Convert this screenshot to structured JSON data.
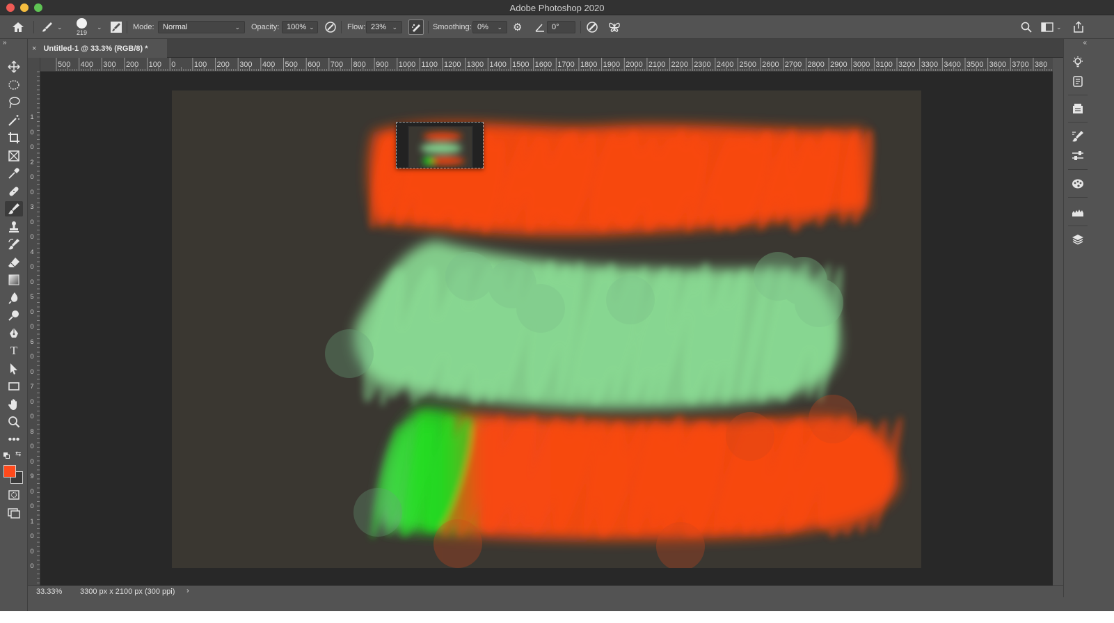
{
  "window": {
    "title": "Adobe Photoshop 2020"
  },
  "options_bar": {
    "brush_size": "219",
    "mode_label": "Mode:",
    "mode_value": "Normal",
    "opacity_label": "Opacity:",
    "opacity_value": "100%",
    "flow_label": "Flow:",
    "flow_value": "23%",
    "smoothing_label": "Smoothing:",
    "smoothing_value": "0%",
    "angle_value": "0°"
  },
  "document": {
    "tab_title": "Untitled-1 @ 33.3% (RGB/8) *",
    "tab_close": "×"
  },
  "ruler": {
    "top_labels": [
      "500",
      "400",
      "300",
      "200",
      "100",
      "0",
      "100",
      "200",
      "300",
      "400",
      "500",
      "600",
      "700",
      "800",
      "900",
      "1000",
      "1100",
      "1200",
      "1300",
      "1400",
      "1500",
      "1600",
      "1700",
      "1800",
      "1900",
      "2000",
      "2100",
      "2200",
      "2300",
      "2400",
      "2500",
      "2600",
      "2700",
      "2800",
      "2900",
      "3000",
      "3100",
      "3200",
      "3300",
      "3400",
      "3500",
      "3600",
      "3700",
      "380"
    ],
    "left_labels": [
      "1",
      "0",
      "0",
      "2",
      "0",
      "0",
      "3",
      "0",
      "0",
      "4",
      "0",
      "0",
      "5",
      "0",
      "0",
      "6",
      "0",
      "0",
      "7",
      "0",
      "0",
      "8",
      "0",
      "0",
      "9",
      "0",
      "0",
      "1",
      "0",
      "0",
      "0"
    ]
  },
  "toolbar": {
    "tools": [
      "move-tool",
      "marquee-tool",
      "lasso-tool",
      "magic-wand-tool",
      "crop-tool",
      "frame-tool",
      "eyedropper-tool",
      "healing-brush-tool",
      "brush-tool",
      "clone-stamp-tool",
      "history-brush-tool",
      "eraser-tool",
      "gradient-tool",
      "blur-tool",
      "dodge-tool",
      "pen-tool",
      "type-tool",
      "path-selection-tool",
      "rectangle-tool",
      "hand-tool",
      "zoom-tool",
      "more-tools"
    ],
    "active_tool": "brush-tool",
    "foreground_color": "#ff4a1c",
    "background_color": "#3a3a3a"
  },
  "colors": {
    "stroke_orange": "#ff4a0a",
    "stroke_mint": "#8fe59a",
    "stroke_green": "#22e622",
    "canvas_bg": "#3a3731"
  },
  "status": {
    "zoom": "33.33%",
    "doc_info": "3300 px x 2100 px (300 ppi)",
    "arrow": "›"
  }
}
